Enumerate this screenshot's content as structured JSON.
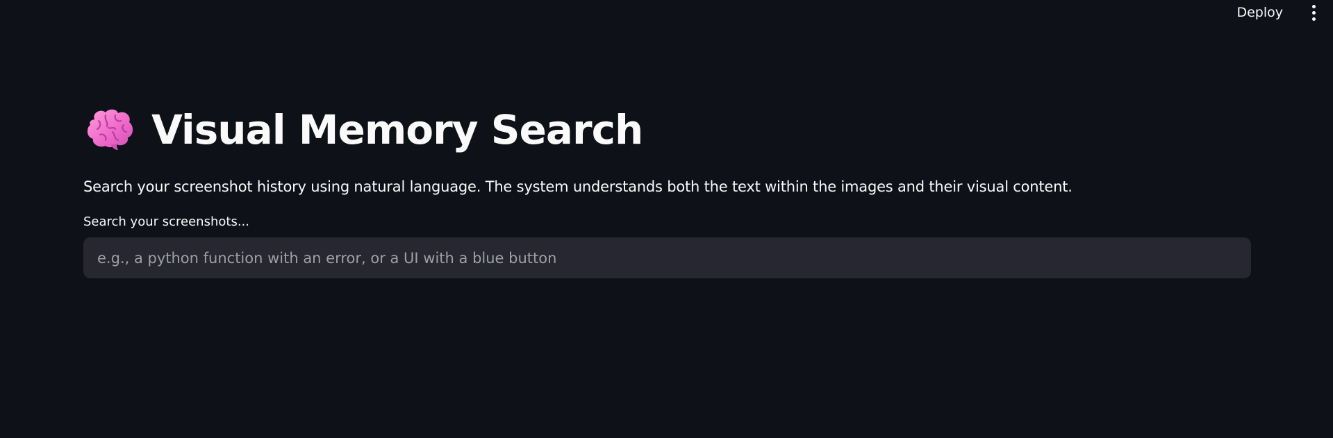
{
  "header": {
    "deploy_label": "Deploy",
    "menu_icon": "vertical-ellipsis-icon"
  },
  "main": {
    "title_icon": "brain-icon",
    "title": "Visual Memory Search",
    "description": "Search your screenshot history using natural language. The system understands both the text within the images and their visual content.",
    "search": {
      "label": "Search your screenshots...",
      "value": "",
      "placeholder": "e.g., a python function with an error, or a UI with a blue button"
    }
  },
  "colors": {
    "background": "#0e1117",
    "input_background": "#262730",
    "text": "#fafafa",
    "placeholder": "#9ea0a6",
    "brain_pink": "#f472d0"
  }
}
